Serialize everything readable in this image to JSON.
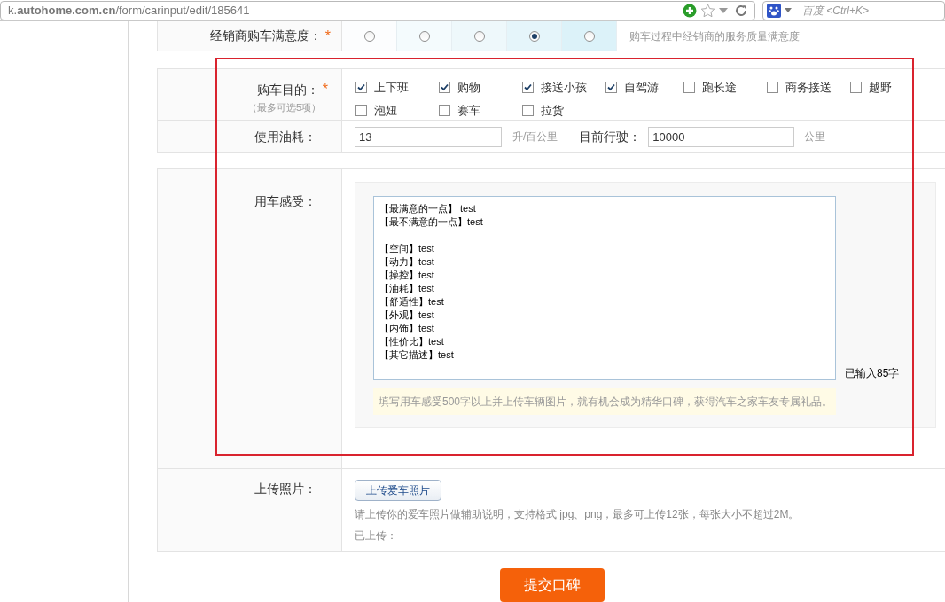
{
  "browser": {
    "url": "k.**autohome.com.cn**/form/carinput/edit/185641",
    "search_placeholder": "百度 <Ctrl+K>"
  },
  "satisfaction": {
    "label": "经销商购车满意度：",
    "required_mark": "*",
    "options": [
      {
        "selected": false
      },
      {
        "selected": false
      },
      {
        "selected": false
      },
      {
        "selected": true
      },
      {
        "selected": false
      }
    ],
    "hint": "购车过程中经销商的服务质量满意度"
  },
  "purpose": {
    "label": "购车目的：",
    "required_mark": "*",
    "sublabel": "（最多可选5项）",
    "options": [
      {
        "label": "上下班",
        "checked": true
      },
      {
        "label": "购物",
        "checked": true
      },
      {
        "label": "接送小孩",
        "checked": true
      },
      {
        "label": "自驾游",
        "checked": true
      },
      {
        "label": "跑长途",
        "checked": false
      },
      {
        "label": "商务接送",
        "checked": false
      },
      {
        "label": "越野",
        "checked": false
      },
      {
        "label": "泡妞",
        "checked": false
      },
      {
        "label": "赛车",
        "checked": false
      },
      {
        "label": "拉货",
        "checked": false
      }
    ]
  },
  "fuel": {
    "label": "使用油耗：",
    "value": "13",
    "unit": "升/百公里",
    "mileage_label": "目前行驶：",
    "mileage_value": "10000",
    "mileage_unit": "公里"
  },
  "feeling": {
    "label": "用车感受：",
    "text": "【最满意的一点】 test\n【最不满意的一点】test\n\n【空间】test\n【动力】test\n【操控】test\n【油耗】test\n【舒适性】test\n【外观】test\n【内饰】test\n【性价比】test\n【其它描述】test",
    "count": "已输入85字",
    "tip": "填写用车感受500字以上并上传车辆图片，就有机会成为精华口碑，获得汽车之家车友专属礼品。"
  },
  "upload": {
    "label": "上传照片：",
    "button": "上传爱车照片",
    "hint": "请上传你的爱车照片做辅助说明，支持格式 jpg、png，最多可上传12张，每张大小不超过2M。",
    "uploaded": "已上传："
  },
  "submit": "提交口碑"
}
